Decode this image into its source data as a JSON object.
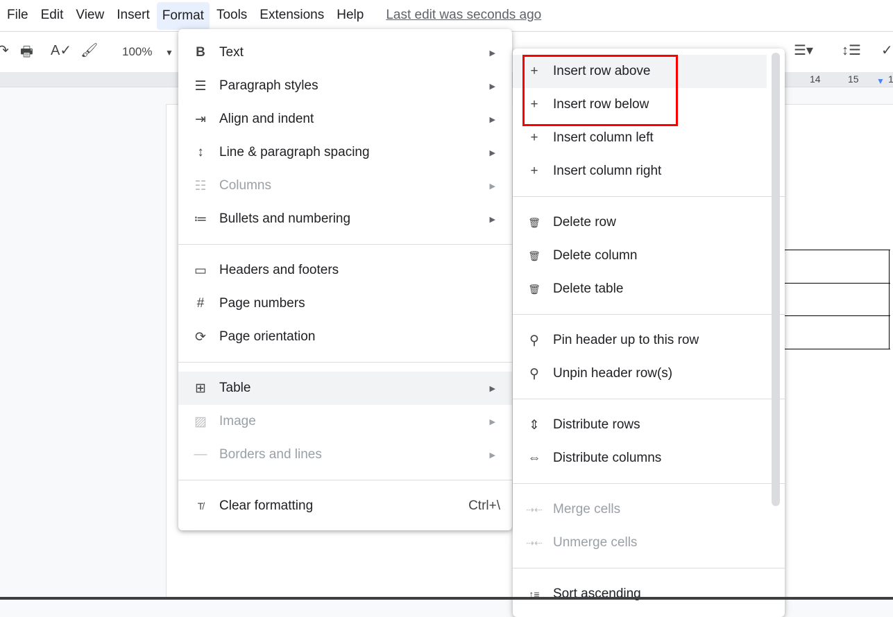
{
  "menubar": {
    "items": [
      "File",
      "Edit",
      "View",
      "Insert",
      "Format",
      "Tools",
      "Extensions",
      "Help"
    ],
    "last_edit": "Last edit was seconds ago"
  },
  "toolbar": {
    "zoom": "100%"
  },
  "ruler": {
    "ticks": [
      "14",
      "15",
      "1"
    ]
  },
  "format_menu": {
    "items": [
      {
        "icon": "bold-icon",
        "glyph": "B",
        "label": "Text",
        "submenu": true
      },
      {
        "icon": "paragraph-styles-icon",
        "glyph": "☰",
        "label": "Paragraph styles",
        "submenu": true
      },
      {
        "icon": "indent-icon",
        "glyph": "⇥",
        "label": "Align and indent",
        "submenu": true
      },
      {
        "icon": "line-spacing-icon",
        "glyph": "↕",
        "label": "Line & paragraph spacing",
        "submenu": true
      },
      {
        "icon": "columns-icon",
        "glyph": "☷",
        "label": "Columns",
        "submenu": true,
        "disabled": true
      },
      {
        "icon": "bullets-icon",
        "glyph": "≔",
        "label": "Bullets and numbering",
        "submenu": true
      },
      {
        "divider": true
      },
      {
        "icon": "header-footer-icon",
        "glyph": "▭",
        "label": "Headers and footers"
      },
      {
        "icon": "hash-icon",
        "glyph": "#",
        "label": "Page numbers"
      },
      {
        "icon": "page-orientation-icon",
        "glyph": "⟳",
        "label": "Page orientation"
      },
      {
        "divider": true
      },
      {
        "icon": "table-icon",
        "glyph": "⊞",
        "label": "Table",
        "submenu": true,
        "highlighted": true
      },
      {
        "icon": "image-icon",
        "glyph": "▨",
        "label": "Image",
        "submenu": true,
        "disabled": true
      },
      {
        "icon": "borders-icon",
        "glyph": "—",
        "label": "Borders and lines",
        "submenu": true,
        "disabled": true
      },
      {
        "divider": true
      },
      {
        "icon": "clear-formatting-icon",
        "glyph": "T̸",
        "label": "Clear formatting",
        "shortcut": "Ctrl+\\"
      }
    ]
  },
  "table_submenu": {
    "items": [
      {
        "icon": "plus-icon",
        "glyph": "+",
        "label": "Insert row above",
        "highlighted": true
      },
      {
        "icon": "plus-icon",
        "glyph": "+",
        "label": "Insert row below"
      },
      {
        "icon": "plus-icon",
        "glyph": "+",
        "label": "Insert column left"
      },
      {
        "icon": "plus-icon",
        "glyph": "+",
        "label": "Insert column right"
      },
      {
        "divider": true
      },
      {
        "icon": "trash-icon",
        "glyph": "🗑",
        "label": "Delete row"
      },
      {
        "icon": "trash-icon",
        "glyph": "🗑",
        "label": "Delete column"
      },
      {
        "icon": "trash-icon",
        "glyph": "🗑",
        "label": "Delete table"
      },
      {
        "divider": true
      },
      {
        "icon": "pin-icon",
        "glyph": "⚲",
        "label": "Pin header up to this row"
      },
      {
        "icon": "unpin-icon",
        "glyph": "⚲",
        "label": "Unpin header row(s)"
      },
      {
        "divider": true
      },
      {
        "icon": "distribute-rows-icon",
        "glyph": "⇕",
        "label": "Distribute rows"
      },
      {
        "icon": "distribute-columns-icon",
        "glyph": "⇔",
        "label": "Distribute columns"
      },
      {
        "divider": true
      },
      {
        "icon": "merge-cells-icon",
        "glyph": "⇢⇠",
        "label": "Merge cells",
        "disabled": true
      },
      {
        "icon": "unmerge-cells-icon",
        "glyph": "⇢⇠",
        "label": "Unmerge cells",
        "disabled": true
      },
      {
        "divider": true
      },
      {
        "icon": "sort-ascending-icon",
        "glyph": "↑≡",
        "label": "Sort ascending"
      }
    ]
  },
  "colors": {
    "highlight_box": "#ff0000",
    "menu_active": "#e8f0fe"
  }
}
